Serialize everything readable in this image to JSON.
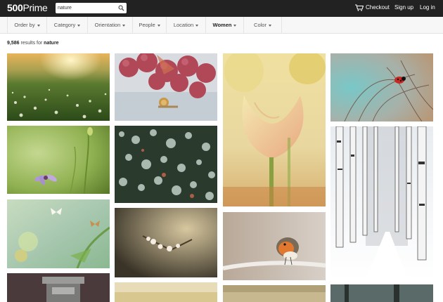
{
  "header": {
    "logo_num": "500",
    "logo_text": "Prime",
    "search_value": "nature",
    "links": {
      "checkout": "Checkout",
      "signup": "Sign up",
      "login": "Log in"
    }
  },
  "filters": [
    {
      "label": "Order by",
      "active": false
    },
    {
      "label": "Category",
      "active": false
    },
    {
      "label": "Orientation",
      "active": false
    },
    {
      "label": "People",
      "active": false
    },
    {
      "label": "Location",
      "active": false
    },
    {
      "label": "Women",
      "active": true
    },
    {
      "label": "Color",
      "active": false
    }
  ],
  "results": {
    "count": "9,586",
    "text": "results for",
    "query": "nature"
  },
  "icons": {
    "search": "search-icon",
    "cart": "cart-icon"
  },
  "colors": {
    "topbar": "#222222",
    "filterbar": "#f7f7f7"
  }
}
